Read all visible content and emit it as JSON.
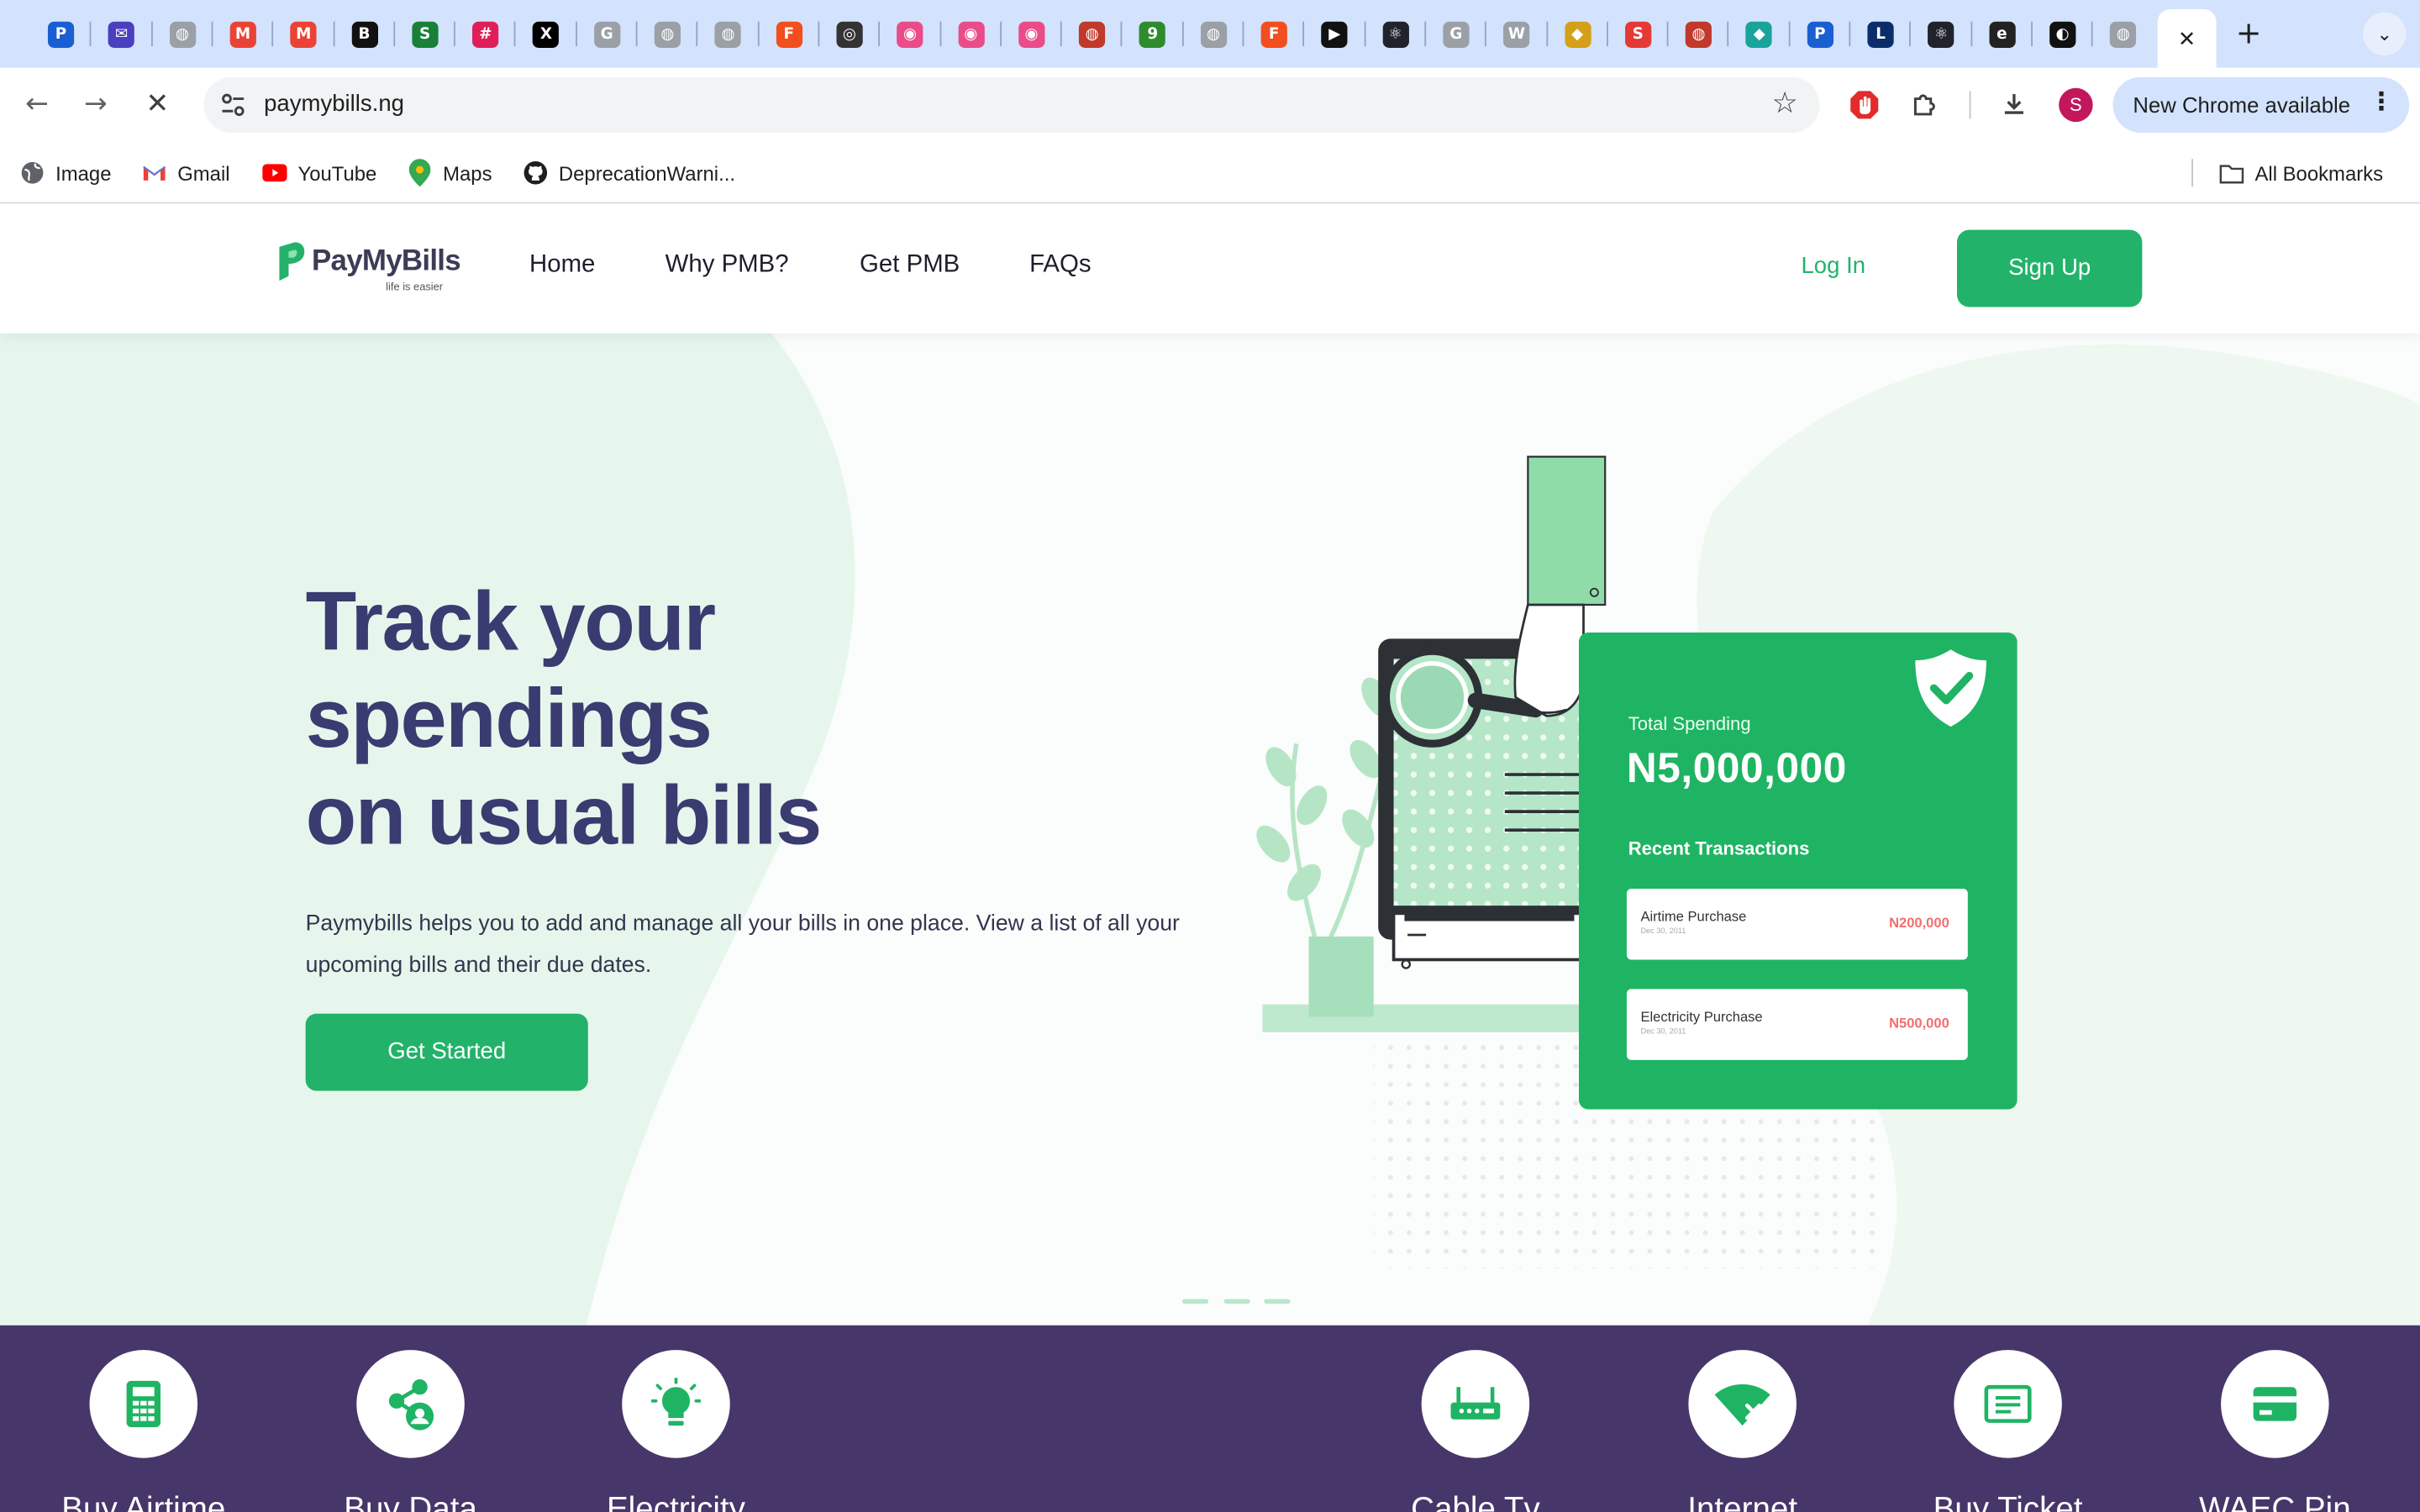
{
  "browser": {
    "tabs": [
      {
        "icon": "pmb-favicon",
        "color": "#1a5fd1",
        "glyph": "P"
      },
      {
        "icon": "mail-favicon",
        "color": "#4a3fbf",
        "glyph": "✉"
      },
      {
        "icon": "globe-favicon",
        "color": "#9aa0a6",
        "glyph": "◍"
      },
      {
        "icon": "gmail-favicon",
        "color": "#ea4335",
        "glyph": "M"
      },
      {
        "icon": "gmail-favicon",
        "color": "#ea4335",
        "glyph": "M"
      },
      {
        "icon": "b-favicon",
        "color": "#111111",
        "glyph": "B"
      },
      {
        "icon": "sheets-favicon",
        "color": "#188038",
        "glyph": "S"
      },
      {
        "icon": "slack-favicon",
        "color": "#e01e5a",
        "glyph": "#"
      },
      {
        "icon": "x-favicon",
        "color": "#000000",
        "glyph": "X"
      },
      {
        "icon": "google-favicon",
        "color": "#9aa0a6",
        "glyph": "G"
      },
      {
        "icon": "globe-favicon",
        "color": "#9aa0a6",
        "glyph": "◍"
      },
      {
        "icon": "globe-favicon",
        "color": "#9aa0a6",
        "glyph": "◍"
      },
      {
        "icon": "figma-favicon",
        "color": "#f24e1e",
        "glyph": "F"
      },
      {
        "icon": "openai-favicon",
        "color": "#333333",
        "glyph": "◎"
      },
      {
        "icon": "dribbble-favicon",
        "color": "#ea4c89",
        "glyph": "◉"
      },
      {
        "icon": "dribbble-favicon",
        "color": "#ea4c89",
        "glyph": "◉"
      },
      {
        "icon": "dribbble-favicon",
        "color": "#ea4c89",
        "glyph": "◉"
      },
      {
        "icon": "globe-favicon",
        "color": "#c0392b",
        "glyph": "◍"
      },
      {
        "icon": "9ja-favicon",
        "color": "#2e8b2e",
        "glyph": "9"
      },
      {
        "icon": "globe-favicon",
        "color": "#9aa0a6",
        "glyph": "◍"
      },
      {
        "icon": "figma-favicon",
        "color": "#f24e1e",
        "glyph": "F"
      },
      {
        "icon": "play-favicon",
        "color": "#111111",
        "glyph": "▶"
      },
      {
        "icon": "react-favicon",
        "color": "#20232a",
        "glyph": "⚛"
      },
      {
        "icon": "google-favicon",
        "color": "#9aa0a6",
        "glyph": "G"
      },
      {
        "icon": "wikipedia-favicon",
        "color": "#9aa0a6",
        "glyph": "W"
      },
      {
        "icon": "bank-favicon",
        "color": "#d4a017",
        "glyph": "◆"
      },
      {
        "icon": "s-favicon",
        "color": "#e53935",
        "glyph": "S"
      },
      {
        "icon": "globe-favicon",
        "color": "#c0392b",
        "glyph": "◍"
      },
      {
        "icon": "diamond-favicon",
        "color": "#1aa39a",
        "glyph": "◆"
      },
      {
        "icon": "pmb-favicon",
        "color": "#1a5fd1",
        "glyph": "P"
      },
      {
        "icon": "live-favicon",
        "color": "#0b2e6b",
        "glyph": "L"
      },
      {
        "icon": "react-favicon",
        "color": "#20232a",
        "glyph": "⚛"
      },
      {
        "icon": "e-favicon",
        "color": "#222222",
        "glyph": "e"
      },
      {
        "icon": "github-favicon",
        "color": "#111111",
        "glyph": "◐"
      },
      {
        "icon": "globe-favicon",
        "color": "#9aa0a6",
        "glyph": "◍"
      }
    ],
    "url": "paymybills.ng",
    "update_label": "New Chrome available",
    "profile_initial": "S",
    "bookmarks": [
      {
        "label": "Image",
        "icon": "globe-icon"
      },
      {
        "label": "Gmail",
        "icon": "gmail-icon"
      },
      {
        "label": "YouTube",
        "icon": "youtube-icon"
      },
      {
        "label": "Maps",
        "icon": "maps-icon"
      },
      {
        "label": "DeprecationWarni...",
        "icon": "github-icon"
      }
    ],
    "all_bookmarks": "All Bookmarks"
  },
  "site": {
    "logo_name": "PayMyBills",
    "logo_tagline": "life is easier",
    "nav": [
      "Home",
      "Why PMB?",
      "Get PMB",
      "FAQs"
    ],
    "login": "Log In",
    "signup": "Sign Up",
    "brand_color": "#23b26a",
    "heading_color": "#3a3b70"
  },
  "hero": {
    "title_lines": [
      "Track your",
      "spendings",
      "on usual bills"
    ],
    "description": "Paymybills helps you to add and manage all your bills in one place. View a list of all your upcoming bills and their due dates.",
    "cta": "Get Started",
    "card": {
      "total_label": "Total Spending",
      "total_value": "N5,000,000",
      "recent_label": "Recent Transactions",
      "transactions": [
        {
          "name": "Airtime Purchase",
          "date": "Dec 30, 2011",
          "amount": "N200,000"
        },
        {
          "name": "Electricity Purchase",
          "date": "Dec 30, 2011",
          "amount": "N500,000"
        }
      ]
    },
    "slides": 3
  },
  "services": [
    {
      "label": "Buy Airtime",
      "icon": "calculator-icon"
    },
    {
      "label": "Buy Data",
      "icon": "share-user-icon"
    },
    {
      "label": "Electricity",
      "icon": "bulb-icon"
    },
    {
      "label": "Cable Tv",
      "icon": "router-icon"
    },
    {
      "label": "Internet",
      "icon": "wifi-off-icon"
    },
    {
      "label": "Buy Ticket",
      "icon": "ticket-icon"
    },
    {
      "label": "WAEC Pin",
      "icon": "card-icon"
    }
  ]
}
